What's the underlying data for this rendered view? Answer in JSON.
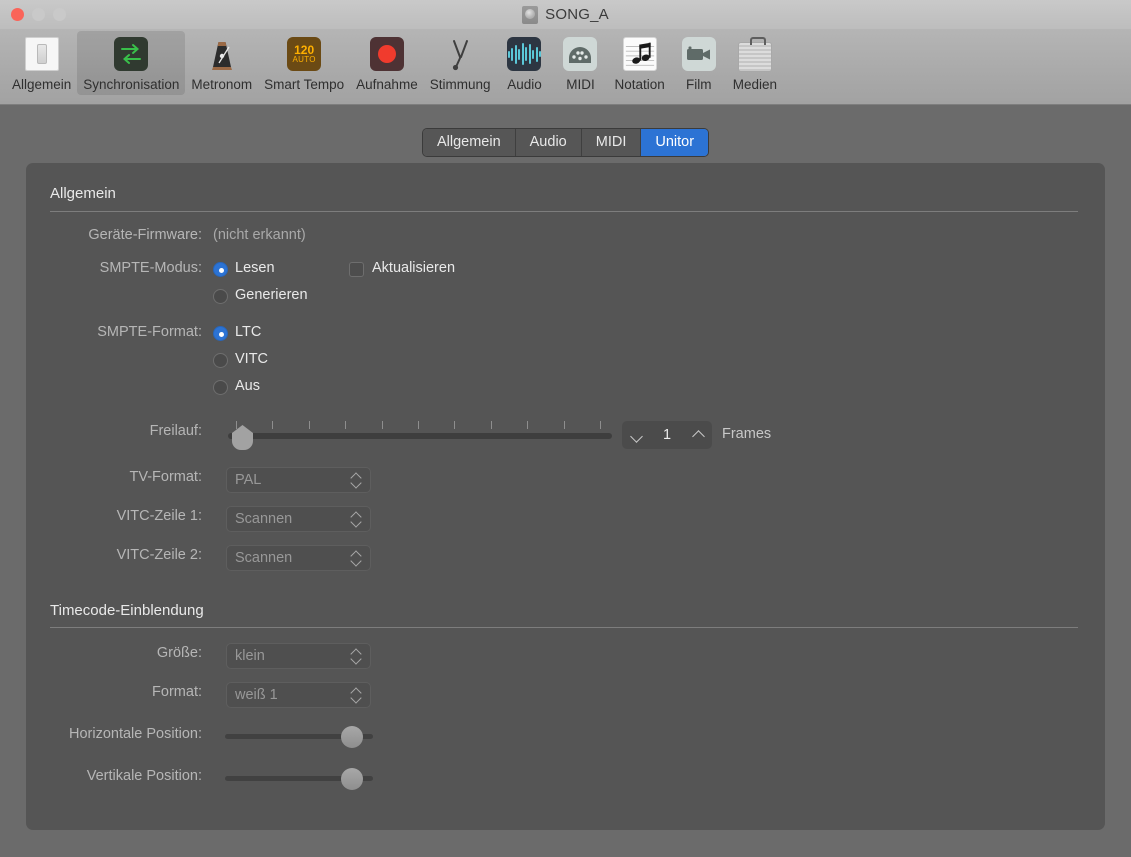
{
  "window": {
    "title": "SONG_A",
    "doc_icon": "project-document-icon",
    "traffic_lights": {
      "close": "close-window-button",
      "minimize": "minimize-window-button",
      "maximize": "maximize-window-button"
    }
  },
  "toolbar": {
    "items": [
      {
        "label": "Allgemein",
        "icon": "switch-icon",
        "selected": false
      },
      {
        "label": "Synchronisation",
        "icon": "sync-arrows-icon",
        "selected": true
      },
      {
        "label": "Metronom",
        "icon": "metronome-icon",
        "selected": false
      },
      {
        "label": "Smart Tempo",
        "icon": "tempo-120-auto-icon",
        "selected": false,
        "badge_top": "120",
        "badge_bottom": "AUTO"
      },
      {
        "label": "Aufnahme",
        "icon": "record-circle-icon",
        "selected": false
      },
      {
        "label": "Stimmung",
        "icon": "tuning-fork-icon",
        "selected": false
      },
      {
        "label": "Audio",
        "icon": "waveform-icon",
        "selected": false
      },
      {
        "label": "MIDI",
        "icon": "midi-connector-icon",
        "selected": false
      },
      {
        "label": "Notation",
        "icon": "music-note-icon",
        "selected": false
      },
      {
        "label": "Film",
        "icon": "video-camera-icon",
        "selected": false
      },
      {
        "label": "Medien",
        "icon": "briefcase-icon",
        "selected": false
      }
    ]
  },
  "tabs": [
    {
      "label": "Allgemein",
      "active": false
    },
    {
      "label": "Audio",
      "active": false
    },
    {
      "label": "MIDI",
      "active": false
    },
    {
      "label": "Unitor",
      "active": true
    }
  ],
  "sections": {
    "allgemein": {
      "title": "Allgemein",
      "firmware": {
        "label": "Geräte-Firmware:",
        "value": "(nicht erkannt)"
      },
      "smpte_mode": {
        "label": "SMPTE-Modus:",
        "options": [
          {
            "label": "Lesen",
            "selected": true
          },
          {
            "label": "Generieren",
            "selected": false
          }
        ],
        "update_checkbox": {
          "label": "Aktualisieren",
          "checked": false
        }
      },
      "smpte_format": {
        "label": "SMPTE-Format:",
        "options": [
          {
            "label": "LTC",
            "selected": true
          },
          {
            "label": "VITC",
            "selected": false
          },
          {
            "label": "Aus",
            "selected": false
          }
        ]
      },
      "freewheel": {
        "label": "Freilauf:",
        "value": "1",
        "unit": "Frames",
        "slider_position_percent": 0,
        "tick_count": 11,
        "stepper_down_icon": "chevron-down-icon",
        "stepper_up_icon": "chevron-up-icon"
      },
      "tv_format": {
        "label": "TV-Format:",
        "value": "PAL",
        "enabled": false
      },
      "vitc_line_1": {
        "label": "VITC-Zeile 1:",
        "value": "Scannen",
        "enabled": false
      },
      "vitc_line_2": {
        "label": "VITC-Zeile 2:",
        "value": "Scannen",
        "enabled": false
      }
    },
    "timecode": {
      "title": "Timecode-Einblendung",
      "size": {
        "label": "Größe:",
        "value": "klein",
        "enabled": false
      },
      "format": {
        "label": "Format:",
        "value": "weiß 1",
        "enabled": false
      },
      "horizontal_position": {
        "label": "Horizontale Position:",
        "value_percent": 92
      },
      "vertical_position": {
        "label": "Vertikale Position:",
        "value_percent": 92
      }
    }
  },
  "colors": {
    "accent": "#2c73d4",
    "panel_bg": "#555555",
    "window_bg": "#6b6b6b",
    "toolbar_bg": "#a9a9a9",
    "record_red": "#f03b2d",
    "close_red": "#fa6459",
    "tempo_orange": "#ffb000",
    "waveform_cyan": "#5bc8d8",
    "sync_green": "#39c04a"
  }
}
